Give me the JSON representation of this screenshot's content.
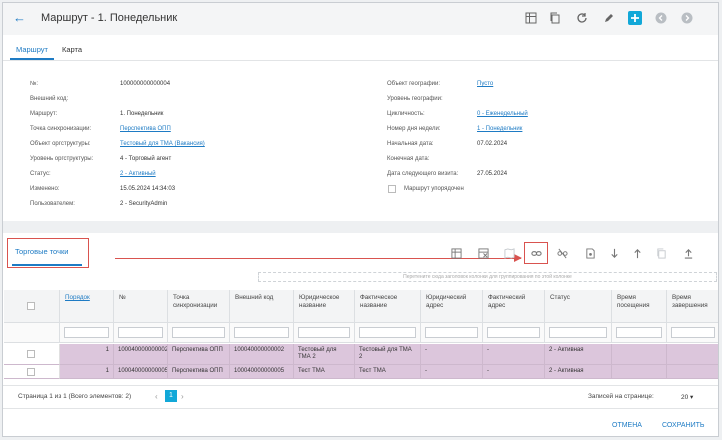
{
  "header": {
    "title": "Маршрут - 1. Понедельник",
    "back_icon": "arrow-left-icon",
    "toolbar_icons": [
      "table-export-icon",
      "copy-icon",
      "refresh-icon",
      "edit-icon",
      "add-icon",
      "prev-circle-icon",
      "next-circle-icon"
    ]
  },
  "tabs": [
    {
      "label": "Маршрут",
      "active": true
    },
    {
      "label": "Карта",
      "active": false
    }
  ],
  "left_fields": [
    {
      "label": "№:",
      "value": "100000000000004",
      "link": false
    },
    {
      "label": "Внешний код:",
      "value": "",
      "link": false
    },
    {
      "label": "Маршрут:",
      "value": "1. Понедельник",
      "link": false
    },
    {
      "label": "Точка синхронизации:",
      "value": "Перспектива ОПП",
      "link": true
    },
    {
      "label": "Объект оргструктуры:",
      "value": "Тестовый для ТМА (Вакансия)",
      "link": true
    },
    {
      "label": "Уровень оргструктуры:",
      "value": "4 - Торговый агент",
      "link": false
    },
    {
      "label": "Статус:",
      "value": "2 - Активный",
      "link": true
    },
    {
      "label": "Изменено:",
      "value": "15.05.2024 14:34:03",
      "link": false
    },
    {
      "label": "Пользователем:",
      "value": "2 - SecurityAdmin",
      "link": false
    }
  ],
  "right_fields": [
    {
      "label": "Объект географии:",
      "value": "Пусто",
      "link": true
    },
    {
      "label": "Уровень географии:",
      "value": "",
      "link": false
    },
    {
      "label": "Цикличность:",
      "value": "0 - Еженедельный",
      "link": true
    },
    {
      "label": "Номер дня недели:",
      "value": "1 - Понедельник",
      "link": true
    },
    {
      "label": "Начальная дата:",
      "value": "07.02.2024",
      "link": false
    },
    {
      "label": "Конечная дата:",
      "value": "",
      "link": false
    },
    {
      "label": "Дата следующего визита:",
      "value": "27.05.2024",
      "link": false
    }
  ],
  "ordered_checkbox": {
    "label": "Маршрут упорядочен",
    "checked": false
  },
  "section": {
    "tab_label": "Торговые точки",
    "group_hint": "Перетените сюда заголовок колонки для группирования по этой колонке",
    "icons": [
      "table-settings-icon",
      "table-export-icon",
      "map-icon",
      "link-icon",
      "unlink-icon",
      "file-icon",
      "arrow-down-icon",
      "arrow-up-icon",
      "copy-icon",
      "upload-icon"
    ]
  },
  "grid": {
    "columns": [
      "",
      "Порядок",
      "№",
      "Точка синхронизации",
      "Внешний код",
      "Юридическое название",
      "Фактическое название",
      "Юридический адрес",
      "Фактический адрес",
      "Статус",
      "Время посещения",
      "Время завершения"
    ],
    "rows": [
      [
        "",
        "1",
        "100040000000002",
        "Перспектива ОПП",
        "100040000000002",
        "Тестовый для ТМА 2",
        "Тестовый для ТМА 2",
        "-",
        "-",
        "2 - Активная",
        "",
        ""
      ],
      [
        "",
        "1",
        "100040000000005",
        "Перспектива ОПП",
        "100040000000005",
        "Тест ТМА",
        "Тест ТМА",
        "-",
        "-",
        "2 - Активная",
        "",
        ""
      ]
    ]
  },
  "pager": {
    "info": "Страница 1 из 1 (Всего элементов: 2)",
    "prev": "‹",
    "page": "1",
    "next": "›",
    "per_page_label": "Записей на странице:",
    "per_page_value": "20 ▾"
  },
  "footer": {
    "cancel": "ОТМЕНА",
    "save": "СОХРАНИТЬ"
  }
}
